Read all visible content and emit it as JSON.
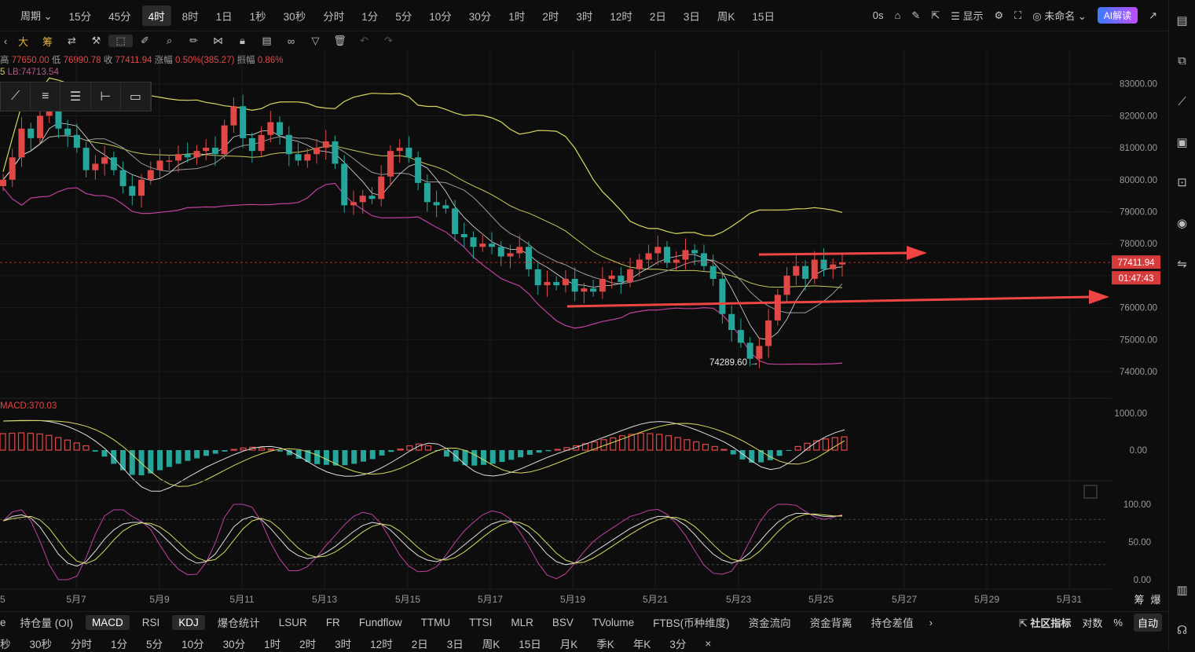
{
  "toolbar": {
    "period_label": "周期",
    "timeframes": [
      "15分",
      "45分",
      "4时",
      "8时",
      "1日",
      "1秒",
      "30秒",
      "分时",
      "1分",
      "5分",
      "10分",
      "30分",
      "1时",
      "2时",
      "3时",
      "12时",
      "2日",
      "3日",
      "周K",
      "15日"
    ],
    "active_timeframe": "4时",
    "countdown": "0s",
    "display_label": "显示",
    "layout_name": "未命名",
    "ai_label": "AI解读"
  },
  "tools_row": {
    "big_label": "大",
    "chip_label": "筹"
  },
  "ohlc": {
    "high_label": "高",
    "high": "77650.00",
    "low_label": "低",
    "low": "76990.78",
    "close_label": "收",
    "close": "77411.94",
    "change_label": "涨幅",
    "change": "0.50%(385.27)",
    "amp_label": "振幅",
    "amp": "0.86%"
  },
  "lb_line": {
    "prefix": "5",
    "text": "LB:74713.54"
  },
  "price_axis": [
    "83000.00",
    "82000.00",
    "81000.00",
    "80000.00",
    "79000.00",
    "78000.00",
    "77000.00",
    "76000.00",
    "75000.00",
    "74000.00"
  ],
  "current_price": "77411.94",
  "countdown_timer": "01:47:43",
  "low_annotation": "74289.60 →",
  "macd": {
    "label": "MACD:370.03",
    "axis": [
      "1000.00",
      "0.00"
    ]
  },
  "kdj": {
    "axis": [
      "100.00",
      "50.00",
      "0.00"
    ]
  },
  "date_axis": [
    "5",
    "5月7",
    "5月9",
    "5月11",
    "5月13",
    "5月15",
    "5月17",
    "5月19",
    "5月21",
    "5月23",
    "5月25",
    "5月27",
    "5月29",
    "5月31"
  ],
  "axis_corner": [
    "筹",
    "爆"
  ],
  "indicator_tabs": [
    "e",
    "持仓量 (OI)",
    "MACD",
    "RSI",
    "KDJ",
    "爆仓统计",
    "LSUR",
    "FR",
    "Fundflow",
    "TTMU",
    "TTSI",
    "MLR",
    "BSV",
    "TVolume",
    "FTBS(币种维度)",
    "资金流向",
    "资金背离",
    "持仓差值"
  ],
  "indicator_tabs_selected": [
    "MACD",
    "KDJ"
  ],
  "indicator_tabs_right": {
    "community": "社区指标",
    "log": "对数",
    "pct": "%",
    "auto": "自动",
    "more": "›"
  },
  "timeframe_tabs": [
    "秒",
    "30秒",
    "分时",
    "1分",
    "5分",
    "10分",
    "30分",
    "1时",
    "2时",
    "3时",
    "12时",
    "2日",
    "3日",
    "周K",
    "15日",
    "月K",
    "季K",
    "年K",
    "3分",
    "×"
  ],
  "colors": {
    "up": "#e04848",
    "down": "#26a69a",
    "bb_outer": "#d8d860",
    "bb_lower": "#c0409a",
    "arrow": "#f04545",
    "price_tag": "#d63a3a"
  },
  "chart_data": {
    "type": "candlestick",
    "price_range": [
      74000,
      83000
    ],
    "closes": [
      80000,
      80700,
      81600,
      81300,
      82000,
      82400,
      81600,
      81400,
      81000,
      80300,
      80500,
      80700,
      80300,
      79800,
      79500,
      80000,
      80300,
      80600,
      80600,
      80800,
      80700,
      80900,
      81000,
      80800,
      81700,
      82300,
      81300,
      80900,
      81400,
      81800,
      81400,
      80800,
      80600,
      80800,
      81000,
      81200,
      80500,
      79200,
      79300,
      79500,
      79400,
      80100,
      80900,
      81000,
      80700,
      79900,
      79300,
      79200,
      79100,
      78300,
      78200,
      77900,
      78000,
      77900,
      77600,
      77700,
      77900,
      77200,
      76700,
      76800,
      76700,
      76900,
      76500,
      76600,
      76500,
      76900,
      77000,
      76800,
      77200,
      77500,
      77700,
      77900,
      77400,
      77500,
      77800,
      77700,
      77300,
      76900,
      75800,
      75300,
      74900,
      74400,
      74800,
      75600,
      76400,
      77000,
      77300,
      76900,
      77500,
      77200,
      77350,
      77412
    ],
    "macd_hist": [
      460,
      470,
      480,
      470,
      450,
      410,
      350,
      280,
      200,
      120,
      -40,
      -180,
      -380,
      -560,
      -690,
      -700,
      -650,
      -560,
      -470,
      -380,
      -300,
      -230,
      -160,
      -100,
      -40,
      20,
      60,
      80,
      60,
      30,
      -40,
      -140,
      -240,
      -330,
      -390,
      -410,
      -430,
      -420,
      -380,
      -320,
      -250,
      -150,
      -50,
      30,
      120,
      170,
      120,
      -20,
      -180,
      -320,
      -420,
      -430,
      -410,
      -380,
      -330,
      -270,
      -200,
      -130,
      -70,
      -30,
      20,
      70,
      120,
      180,
      230,
      290,
      340,
      400,
      440,
      470,
      460,
      440,
      400,
      350,
      290,
      230,
      160,
      100,
      20,
      -120,
      -260,
      -350,
      -340,
      -280,
      -160,
      -20,
      100,
      190,
      260,
      310,
      350,
      370
    ],
    "k_values": [
      78,
      84,
      86,
      82,
      70,
      52,
      34,
      22,
      18,
      24,
      38,
      54,
      66,
      74,
      76,
      76,
      72,
      62,
      50,
      38,
      28,
      22,
      24,
      34,
      52,
      70,
      80,
      84,
      80,
      68,
      54,
      40,
      32,
      28,
      30,
      36,
      44,
      54,
      64,
      72,
      76,
      74,
      66,
      54,
      42,
      32,
      26,
      24,
      28,
      36,
      46,
      56,
      66,
      74,
      78,
      78,
      72,
      62,
      48,
      34,
      24,
      20,
      22,
      28,
      36,
      44,
      52,
      60,
      68,
      74,
      80,
      84,
      84,
      80,
      72,
      60,
      46,
      34,
      26,
      22,
      26,
      36,
      50,
      64,
      76,
      84,
      88,
      88,
      86,
      84,
      84,
      85
    ]
  }
}
